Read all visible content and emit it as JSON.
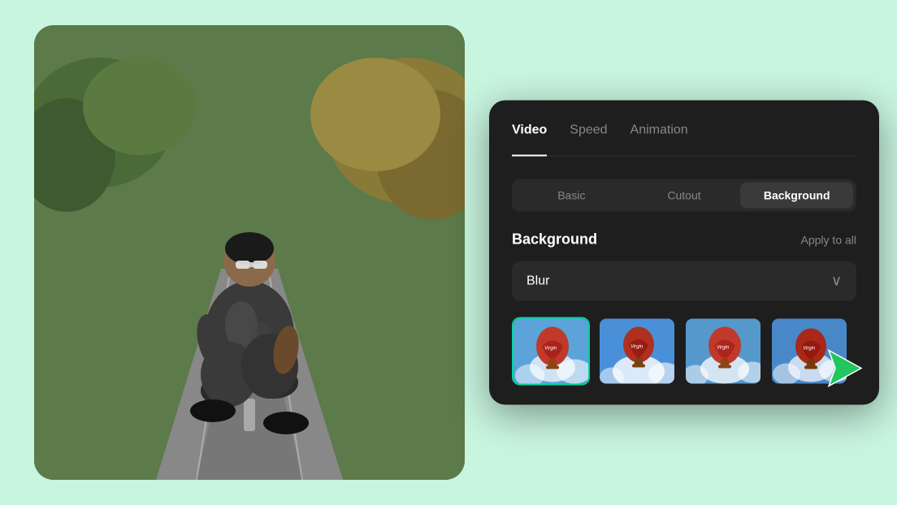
{
  "tabs": {
    "items": [
      {
        "label": "Video",
        "active": true
      },
      {
        "label": "Speed",
        "active": false
      },
      {
        "label": "Animation",
        "active": false
      }
    ]
  },
  "sub_tabs": {
    "items": [
      {
        "label": "Basic",
        "active": false
      },
      {
        "label": "Cutout",
        "active": false
      },
      {
        "label": "Background",
        "active": true
      }
    ]
  },
  "section": {
    "title": "Background",
    "apply_all_label": "Apply to all"
  },
  "dropdown": {
    "label": "Blur",
    "chevron": "∨"
  },
  "thumbnails": [
    {
      "id": 1,
      "selected": true
    },
    {
      "id": 2,
      "selected": false
    },
    {
      "id": 3,
      "selected": false
    },
    {
      "id": 4,
      "selected": false
    }
  ],
  "colors": {
    "panel_bg": "#1e1e1e",
    "active_tab_underline": "#ffffff",
    "selected_thumb_border": "#00d4a0",
    "green_arrow": "#22c55e",
    "bg_mint": "#c8f5e0"
  }
}
